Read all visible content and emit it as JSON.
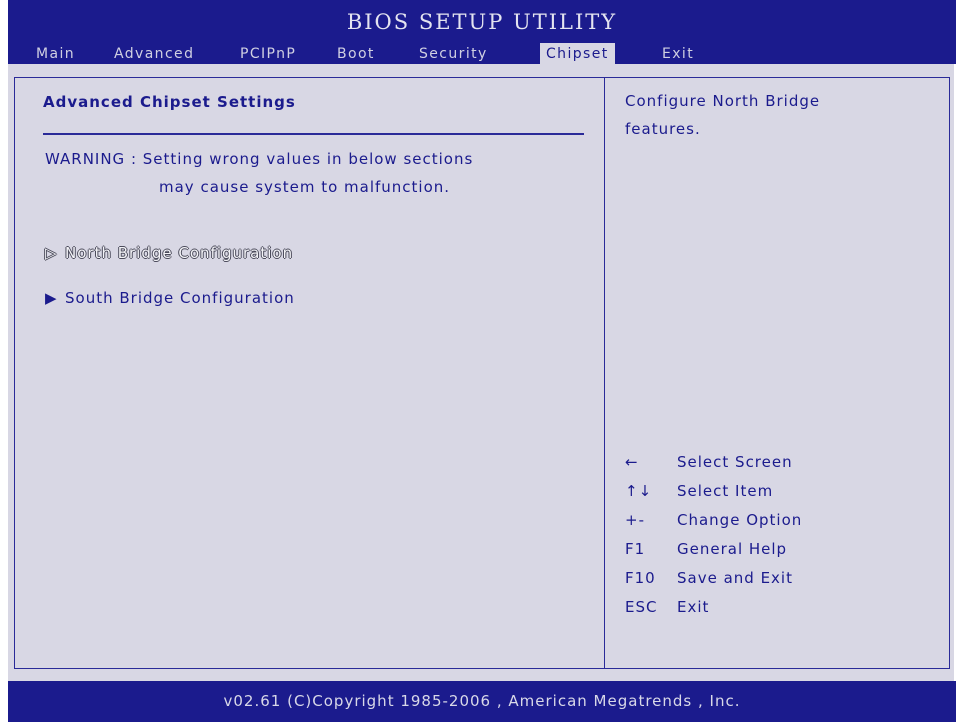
{
  "header": {
    "title": "BIOS SETUP UTILITY",
    "tabs": [
      {
        "label": "Main"
      },
      {
        "label": "Advanced"
      },
      {
        "label": "PCIPnP"
      },
      {
        "label": "Boot"
      },
      {
        "label": "Security"
      },
      {
        "label": "Chipset",
        "active": true
      },
      {
        "label": "Exit"
      }
    ]
  },
  "main": {
    "section_title": "Advanced Chipset Settings",
    "warning_line1": "WARNING : Setting wrong values in below sections",
    "warning_line2": "may cause system to malfunction.",
    "items": [
      {
        "label": "North Bridge Configuration",
        "arrow": "▷",
        "selected": true
      },
      {
        "label": "South Bridge Configuration",
        "arrow": "▶",
        "selected": false
      }
    ]
  },
  "help": {
    "line1": "Configure North Bridge",
    "line2": "features.",
    "keys": [
      {
        "key": "←",
        "action": "Select Screen"
      },
      {
        "key": "↑↓",
        "action": "Select Item"
      },
      {
        "key": "+-",
        "action": "Change Option"
      },
      {
        "key": "F1",
        "action": "General Help"
      },
      {
        "key": "F10",
        "action": "Save and Exit"
      },
      {
        "key": "ESC",
        "action": "Exit"
      }
    ]
  },
  "footer": {
    "text": "v02.61  (C)Copyright 1985-2006 , American Megatrends , Inc."
  },
  "colors": {
    "bar_blue": "#1b1b8d",
    "panel_bg": "#d8d7e4",
    "text_blue": "#1b1b8d"
  }
}
